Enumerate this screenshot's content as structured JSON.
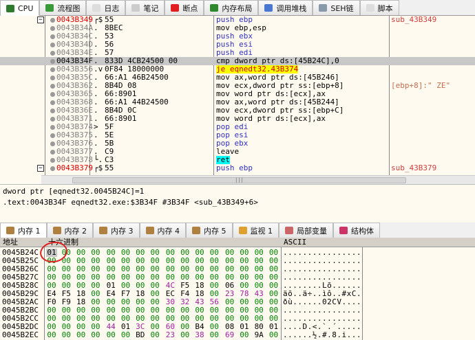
{
  "top_tabs": [
    {
      "label": "CPU",
      "icon": "cpu-icon",
      "color": "#2f7a2f",
      "active": true
    },
    {
      "label": "流程图",
      "icon": "graph-icon",
      "color": "#3a9a3a"
    },
    {
      "label": "日志",
      "icon": "log-icon",
      "color": "#dddddd"
    },
    {
      "label": "笔记",
      "icon": "notes-icon",
      "color": "#cccccc"
    },
    {
      "label": "断点",
      "icon": "breakpoint-icon",
      "color": "#e02020"
    },
    {
      "label": "内存布局",
      "icon": "memory-map-icon",
      "color": "#2f8a2f"
    },
    {
      "label": "调用堆栈",
      "icon": "call-stack-icon",
      "color": "#4a78d0"
    },
    {
      "label": "SEH链",
      "icon": "seh-icon",
      "color": "#8899aa"
    },
    {
      "label": "脚本",
      "icon": "script-icon",
      "color": "#dddddd"
    }
  ],
  "disasm": [
    {
      "addr": "0043B349",
      "mark": "┌$",
      "bytes": "55",
      "ins": "push ebp",
      "cmt": "sub_43B349",
      "addr_style": "red",
      "collapse": true
    },
    {
      "addr": "0043B34A",
      "mark": ".",
      "bytes": "8BEC",
      "ins": "mov ebp,esp"
    },
    {
      "addr": "0043B34C",
      "mark": ".",
      "bytes": "53",
      "ins": "push ebx"
    },
    {
      "addr": "0043B34D",
      "mark": ".",
      "bytes": "56",
      "ins": "push esi"
    },
    {
      "addr": "0043B34E",
      "mark": ".",
      "bytes": "57",
      "ins": "push edi"
    },
    {
      "addr": "0043B34F",
      "mark": ".",
      "bytes": "833D 4CB24500 00",
      "ins": "cmp dword ptr ds:[45B24C],0",
      "selected": true
    },
    {
      "addr": "0043B356",
      "mark": ".v",
      "bytes": "0F84 18000000",
      "ins": "je eqnedt32.43B374"
    },
    {
      "addr": "0043B35C",
      "mark": ".",
      "bytes": "66:A1 46B24500",
      "ins": "mov ax,word ptr ds:[45B246]"
    },
    {
      "addr": "0043B362",
      "mark": ".",
      "bytes": "8B4D 08",
      "ins": "mov ecx,dword ptr ss:[ebp+8]",
      "cmt": "[ebp+8]:\" ZE\"",
      "cmt_style": "dark"
    },
    {
      "addr": "0043B365",
      "mark": ".",
      "bytes": "66:8901",
      "ins": "mov word ptr ds:[ecx],ax"
    },
    {
      "addr": "0043B368",
      "mark": ".",
      "bytes": "66:A1 44B24500",
      "ins": "mov ax,word ptr ds:[45B244]"
    },
    {
      "addr": "0043B36E",
      "mark": ".",
      "bytes": "8B4D 0C",
      "ins": "mov ecx,dword ptr ss:[ebp+C]"
    },
    {
      "addr": "0043B371",
      "mark": ".",
      "bytes": "66:8901",
      "ins": "mov word ptr ds:[ecx],ax"
    },
    {
      "addr": "0043B374",
      "mark": ">",
      "bytes": "5F",
      "ins": "pop edi"
    },
    {
      "addr": "0043B375",
      "mark": ".",
      "bytes": "5E",
      "ins": "pop esi"
    },
    {
      "addr": "0043B376",
      "mark": ".",
      "bytes": "5B",
      "ins": "pop ebx"
    },
    {
      "addr": "0043B377",
      "mark": ".",
      "bytes": "C9",
      "ins": "leave"
    },
    {
      "addr": "0043B378",
      "mark": "└.",
      "bytes": "C3",
      "ins": "ret"
    },
    {
      "addr": "0043B379",
      "mark": "┌$",
      "bytes": "55",
      "ins": "push ebp",
      "cmt": "sub_43B379",
      "addr_style": "red",
      "collapse": true
    }
  ],
  "info": {
    "line1": "dword ptr [eqnedt32.0045B24C]=1",
    "line2": "",
    "line3": ".text:0043B34F eqnedt32.exe:$3B34F #3B34F <sub_43B349+6>"
  },
  "mem_tabs": [
    {
      "label": "内存 1",
      "icon": "memory-icon",
      "color": "#b08040",
      "active": true
    },
    {
      "label": "内存 2",
      "icon": "memory-icon",
      "color": "#b08040"
    },
    {
      "label": "内存 3",
      "icon": "memory-icon",
      "color": "#b08040"
    },
    {
      "label": "内存 4",
      "icon": "memory-icon",
      "color": "#b08040"
    },
    {
      "label": "内存 5",
      "icon": "memory-icon",
      "color": "#b08040"
    },
    {
      "label": "监视 1",
      "icon": "watch-icon",
      "color": "#e0a030"
    },
    {
      "label": "局部变量",
      "icon": "locals-icon",
      "color": "#cc6666"
    },
    {
      "label": "结构体",
      "icon": "struct-icon",
      "color": "#cc3366"
    }
  ],
  "dump_header": {
    "address": "地址",
    "hex": "十六进制",
    "ascii": "ASCII"
  },
  "dump": [
    {
      "addr": "0045B24C",
      "hex": [
        "01",
        "00",
        "00",
        "00",
        "00",
        "00",
        "00",
        "00",
        "00",
        "00",
        "00",
        "00",
        "00",
        "00",
        "00",
        "00"
      ],
      "ascii": "................"
    },
    {
      "addr": "0045B25C",
      "hex": [
        "00",
        "00",
        "00",
        "00",
        "00",
        "00",
        "00",
        "00",
        "00",
        "00",
        "00",
        "00",
        "00",
        "00",
        "00",
        "00"
      ],
      "ascii": "................"
    },
    {
      "addr": "0045B26C",
      "hex": [
        "00",
        "00",
        "00",
        "00",
        "00",
        "00",
        "00",
        "00",
        "00",
        "00",
        "00",
        "00",
        "00",
        "00",
        "00",
        "00"
      ],
      "ascii": "................"
    },
    {
      "addr": "0045B27C",
      "hex": [
        "00",
        "00",
        "00",
        "00",
        "00",
        "00",
        "00",
        "00",
        "00",
        "00",
        "00",
        "00",
        "00",
        "00",
        "00",
        "00"
      ],
      "ascii": "................"
    },
    {
      "addr": "0045B28C",
      "hex": [
        "00",
        "00",
        "00",
        "00",
        "01",
        "00",
        "00",
        "00",
        "4C",
        "F5",
        "18",
        "00",
        "06",
        "00",
        "00",
        "00"
      ],
      "ascii": "........Lõ......"
    },
    {
      "addr": "0045B29C",
      "hex": [
        "E4",
        "F5",
        "18",
        "00",
        "E4",
        "F7",
        "18",
        "00",
        "EC",
        "F4",
        "18",
        "00",
        "23",
        "78",
        "43",
        "00"
      ],
      "ascii": "äõ..ä÷..ìô..#xC."
    },
    {
      "addr": "0045B2AC",
      "hex": [
        "F0",
        "F9",
        "18",
        "00",
        "00",
        "00",
        "00",
        "00",
        "30",
        "32",
        "43",
        "56",
        "00",
        "00",
        "00",
        "00"
      ],
      "ascii": "ðù......02CV...."
    },
    {
      "addr": "0045B2BC",
      "hex": [
        "00",
        "00",
        "00",
        "00",
        "00",
        "00",
        "00",
        "00",
        "00",
        "00",
        "00",
        "00",
        "00",
        "00",
        "00",
        "00"
      ],
      "ascii": "................"
    },
    {
      "addr": "0045B2CC",
      "hex": [
        "00",
        "00",
        "00",
        "00",
        "00",
        "00",
        "00",
        "00",
        "00",
        "00",
        "00",
        "00",
        "00",
        "00",
        "00",
        "00"
      ],
      "ascii": "................"
    },
    {
      "addr": "0045B2DC",
      "hex": [
        "00",
        "00",
        "00",
        "00",
        "44",
        "01",
        "3C",
        "00",
        "60",
        "00",
        "B4",
        "00",
        "08",
        "01",
        "80",
        "01"
      ],
      "ascii": "....D.<.`.´....."
    },
    {
      "addr": "0045B2EC",
      "hex": [
        "00",
        "00",
        "00",
        "00",
        "00",
        "00",
        "BD",
        "00",
        "23",
        "00",
        "38",
        "00",
        "69",
        "00",
        "9A",
        "00"
      ],
      "ascii": "......½.#.8.i..."
    }
  ]
}
